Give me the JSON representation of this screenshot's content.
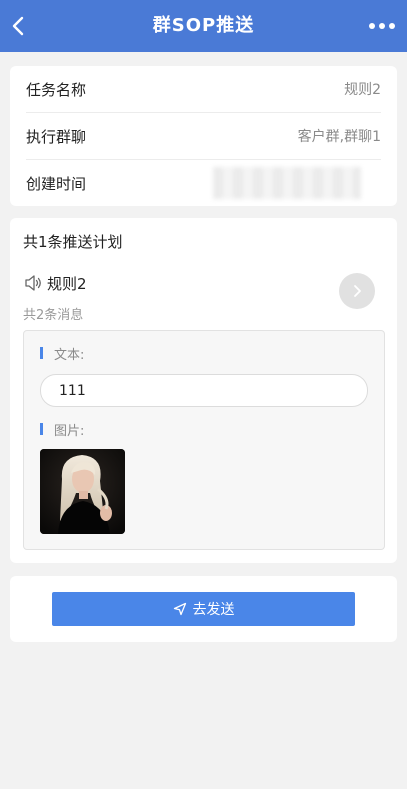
{
  "header": {
    "title": "群SOP推送",
    "back_icon": "chevron-left-icon",
    "more_icon": "more-horizontal-icon"
  },
  "task_info": {
    "rows": [
      {
        "label": "任务名称",
        "value": "规则2"
      },
      {
        "label": "执行群聊",
        "value": "客户群,群聊1"
      },
      {
        "label": "创建时间",
        "value": ""
      }
    ]
  },
  "plan": {
    "title": "共1条推送计划",
    "rule_name": "规则2",
    "message_count": "共2条消息",
    "text_label": "文本:",
    "text_value": "111",
    "image_label": "图片:"
  },
  "actions": {
    "send_label": "去发送"
  },
  "colors": {
    "header_bg": "#4a7ad6",
    "accent": "#4a86e8",
    "page_bg": "#f2f2f2"
  }
}
